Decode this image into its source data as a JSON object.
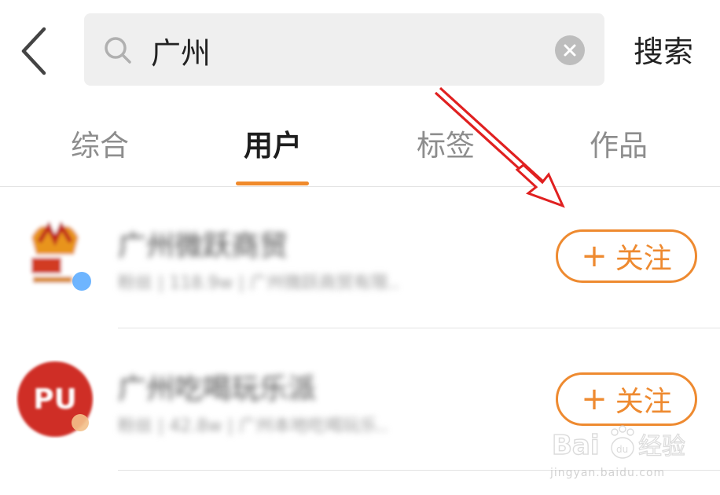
{
  "header": {
    "back_icon": "chevron-left-icon",
    "search": {
      "value": "广州",
      "placeholder": ""
    },
    "search_action": "搜索"
  },
  "tabs": [
    {
      "label": "综合",
      "active": false
    },
    {
      "label": "用户",
      "active": true
    },
    {
      "label": "标签",
      "active": false
    },
    {
      "label": "作品",
      "active": false
    }
  ],
  "results": [
    {
      "name": "广州微跃商贸",
      "meta": "粉丝 | 118.9w | 广州微跃商贸有限..",
      "follow_label": "关注"
    },
    {
      "name": "广州吃喝玩乐派",
      "meta": "粉丝 | 42.8w | 广州本地吃喝玩乐..",
      "follow_label": "关注"
    }
  ],
  "annotation": {
    "arrow_color": "#e02020"
  },
  "colors": {
    "accent": "#ee8a30",
    "verified": "#4aa3ff"
  },
  "watermark": {
    "brand": "Baidu经验",
    "url": "jingyan.baidu.com"
  }
}
